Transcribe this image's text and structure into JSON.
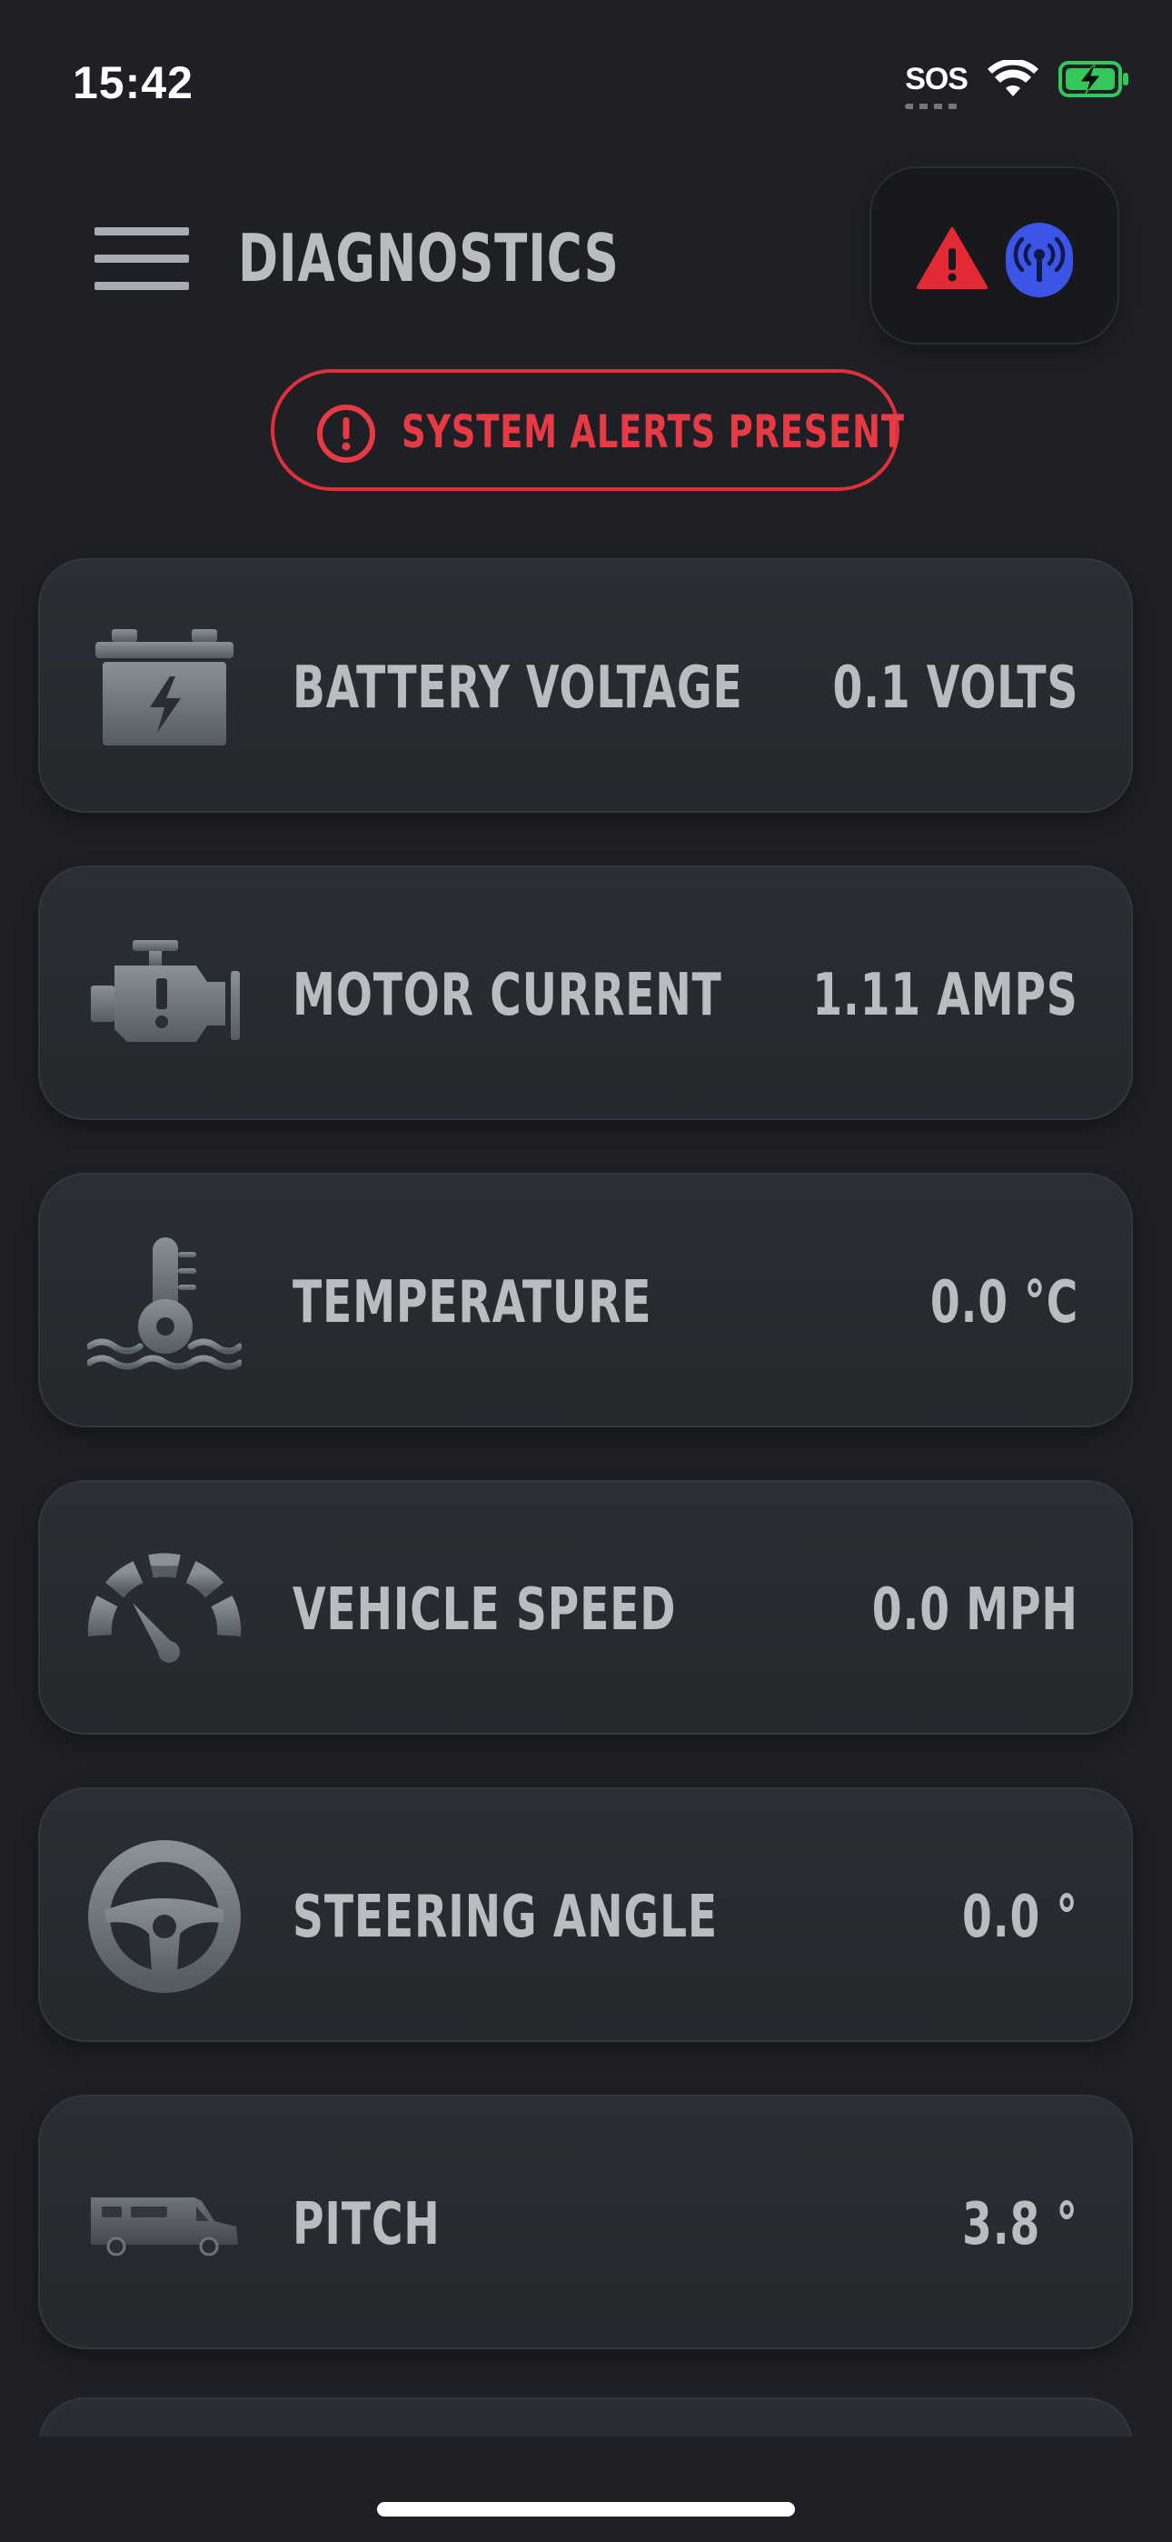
{
  "status_bar": {
    "time": "15:42",
    "sos": "SOS"
  },
  "header": {
    "title": "DIAGNOSTICS"
  },
  "alert": {
    "text": "SYSTEM ALERTS PRESENT"
  },
  "metrics": [
    {
      "label": "BATTERY VOLTAGE",
      "value": "0.1 VOLTS",
      "icon": "battery-icon"
    },
    {
      "label": "MOTOR CURRENT",
      "value": "1.11 AMPS",
      "icon": "engine-icon"
    },
    {
      "label": "TEMPERATURE",
      "value": "0.0 °C",
      "icon": "thermometer-icon"
    },
    {
      "label": "VEHICLE SPEED",
      "value": "0.0 MPH",
      "icon": "speedometer-icon"
    },
    {
      "label": "STEERING ANGLE",
      "value": "0.0 °",
      "icon": "steering-wheel-icon"
    },
    {
      "label": "PITCH",
      "value": "3.8 °",
      "icon": "rv-icon"
    }
  ],
  "colors": {
    "background": "#1e2025",
    "alert": "#e0303a",
    "accent_blue": "#3c55e6",
    "battery_green": "#34c759"
  }
}
